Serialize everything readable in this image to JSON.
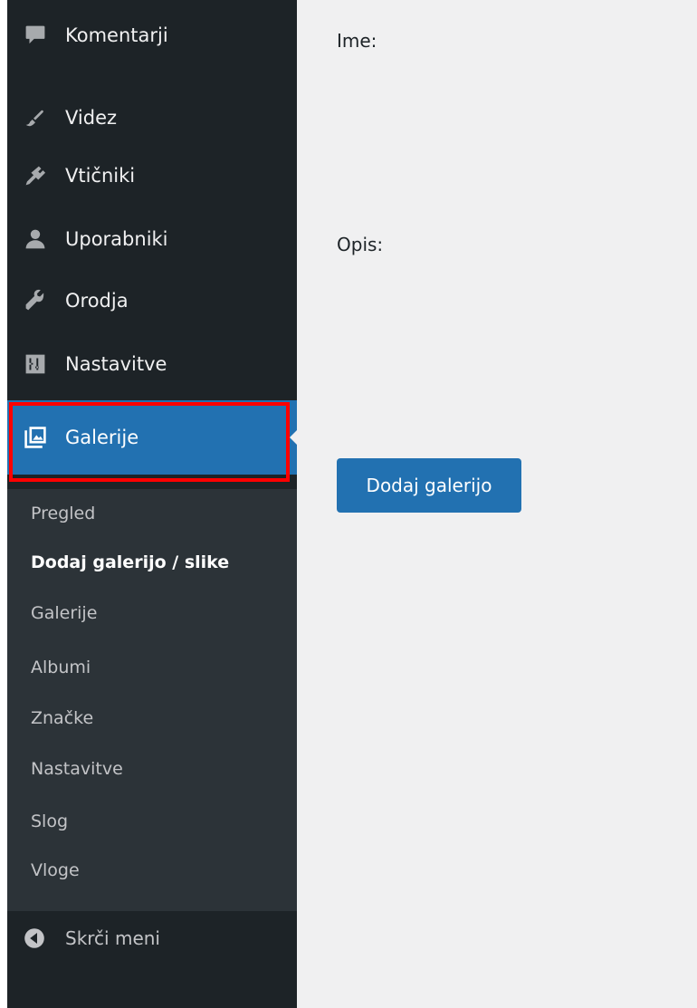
{
  "sidebar": {
    "items": [
      {
        "label": "Komentarji",
        "icon": "comment-icon"
      },
      {
        "label": "Videz",
        "icon": "paint-brush-icon"
      },
      {
        "label": "Vtičniki",
        "icon": "plugin-icon"
      },
      {
        "label": "Uporabniki",
        "icon": "user-icon"
      },
      {
        "label": "Orodja",
        "icon": "wrench-icon"
      },
      {
        "label": "Nastavitve",
        "icon": "sliders-icon"
      },
      {
        "label": "Galerije",
        "icon": "gallery-icon",
        "active": true
      }
    ],
    "submenu": [
      {
        "label": "Pregled"
      },
      {
        "label": "Dodaj galerijo / slike",
        "current": true
      },
      {
        "label": "Galerije"
      },
      {
        "label": "Albumi"
      },
      {
        "label": "Značke"
      },
      {
        "label": "Nastavitve"
      },
      {
        "label": "Slog"
      },
      {
        "label": "Vloge"
      }
    ],
    "collapse_label": "Skrči meni"
  },
  "form": {
    "name_label": "Ime:",
    "description_label": "Opis:",
    "submit_label": "Dodaj galerijo"
  },
  "colors": {
    "sidebar_bg": "#1d2327",
    "submenu_bg": "#2c3338",
    "accent": "#2271b1",
    "highlight": "#ff0000",
    "content_bg": "#f0f0f1"
  }
}
